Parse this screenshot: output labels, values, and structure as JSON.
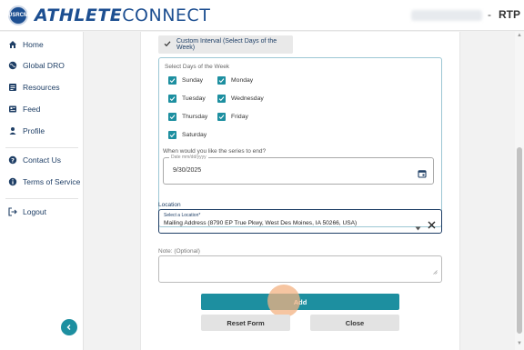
{
  "header": {
    "logo_badge": "USRCM",
    "logo_primary": "ATHLETE",
    "logo_secondary": "CONNECT",
    "separator": "-",
    "user_initials": "RTP"
  },
  "sidebar": {
    "items": [
      {
        "label": "Home",
        "icon": "home-icon"
      },
      {
        "label": "Global DRO",
        "icon": "globe-icon"
      },
      {
        "label": "Resources",
        "icon": "resources-icon"
      },
      {
        "label": "Feed",
        "icon": "feed-icon"
      },
      {
        "label": "Profile",
        "icon": "person-icon"
      },
      {
        "label": "Contact Us",
        "icon": "help-icon"
      },
      {
        "label": "Terms of Service",
        "icon": "info-icon"
      },
      {
        "label": "Logout",
        "icon": "logout-icon"
      }
    ]
  },
  "form": {
    "interval_option": "Custom Interval (Select Days of the Week)",
    "days_title": "Select Days of the Week",
    "days": [
      {
        "label": "Sunday",
        "checked": true
      },
      {
        "label": "Monday",
        "checked": true
      },
      {
        "label": "Tuesday",
        "checked": true
      },
      {
        "label": "Wednesday",
        "checked": true
      },
      {
        "label": "Thursday",
        "checked": true
      },
      {
        "label": "Friday",
        "checked": true
      },
      {
        "label": "Saturday",
        "checked": true
      }
    ],
    "end_question": "When would you like the series to end?",
    "date_placeholder": "Date mm/dd/yyyy",
    "end_date": "9/30/2025",
    "location_label": "Location",
    "location_placeholder": "Select a Location*",
    "location_value": "Mailing Address (8790 EP True Pkwy, West Des Moines, IA 50266, USA)",
    "note_label": "Note: (Optional)",
    "note_value": "",
    "add_label": "Add",
    "reset_label": "Reset Form",
    "close_label": "Close"
  },
  "colors": {
    "brand": "#1d4f91",
    "accent": "#1d8fa0",
    "nav_text": "#1f3f66"
  }
}
